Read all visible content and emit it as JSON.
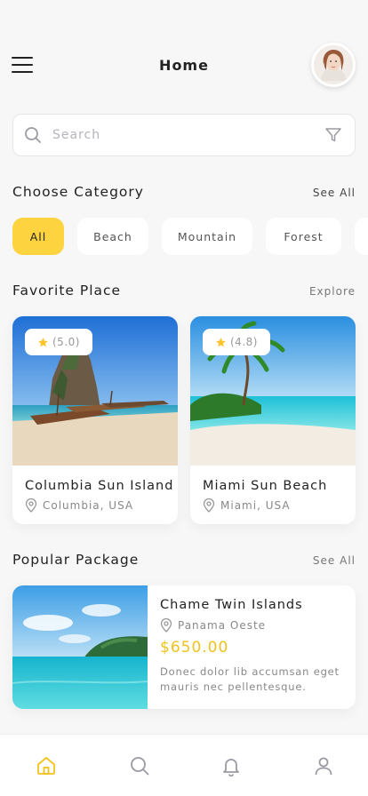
{
  "header": {
    "title": "Home",
    "menu_icon": "hamburger-menu-icon",
    "avatar_icon": "user-avatar"
  },
  "search": {
    "placeholder": "Search",
    "value": "",
    "leading_icon": "search-icon",
    "trailing_icon": "filter-icon"
  },
  "categories": {
    "title": "Choose Category",
    "link": "See All",
    "items": [
      {
        "label": "All",
        "active": true
      },
      {
        "label": "Beach",
        "active": false
      },
      {
        "label": "Mountain",
        "active": false
      },
      {
        "label": "Forest",
        "active": false
      }
    ]
  },
  "favorites": {
    "title": "Favorite Place",
    "link": "Explore",
    "items": [
      {
        "name": "Columbia Sun Island",
        "location": "Columbia, USA",
        "rating": "(5.0)"
      },
      {
        "name": "Miami Sun Beach",
        "location": "Miami, USA",
        "rating": "(4.8)"
      }
    ]
  },
  "popular": {
    "title": "Popular Package",
    "link": "See All",
    "items": [
      {
        "name": "Chame Twin Islands",
        "location": "Panama Oeste",
        "price": "$650.00",
        "description": "Donec dolor lib accumsan eget mauris nec pellentesque."
      }
    ]
  },
  "bottom_nav": {
    "items": [
      "home-icon",
      "search-icon",
      "bell-icon",
      "profile-icon"
    ],
    "active": "home-icon"
  },
  "colors": {
    "accent": "#FDD33F",
    "price": "#F2C21C",
    "background": "#F7F7F8",
    "card": "#FFFFFF"
  }
}
